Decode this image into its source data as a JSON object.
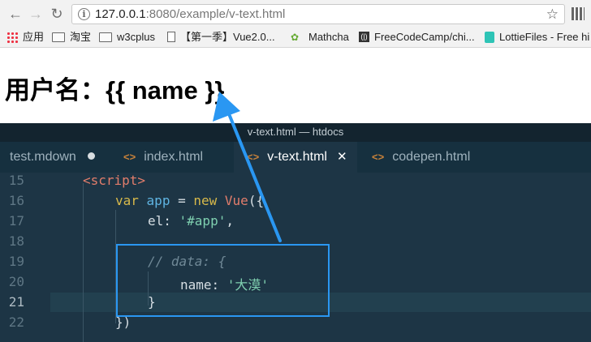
{
  "browser": {
    "url_host": "127.0.0.1",
    "url_rest": ":8080/example/v-text.html",
    "bookmarks": [
      "应用",
      "淘宝",
      "w3cplus",
      "【第一季】Vue2.0...",
      "Mathcha",
      "FreeCodeCamp/chi...",
      "LottieFiles - Free hi"
    ],
    "nav_back": "←",
    "nav_forward": "→",
    "nav_reload": "↻",
    "star": "☆"
  },
  "page": {
    "heading": "用户名：{{ name }}"
  },
  "editor": {
    "window_title": "v-text.html — htdocs",
    "tabs": [
      {
        "label": "test.mdown",
        "modified": true
      },
      {
        "label": "index.html"
      },
      {
        "label": "v-text.html",
        "active": true,
        "close": "✕"
      },
      {
        "label": "codepen.html"
      }
    ],
    "code_icon": "<>",
    "line_numbers": [
      "15",
      "16",
      "17",
      "18",
      "19",
      "20",
      "21",
      "22"
    ],
    "code": {
      "l15": "<script>",
      "l16_kw1": "var",
      "l16_var": "app",
      "l16_op": " = ",
      "l16_kw2": "new",
      "l16_cls": "Vue",
      "l16_end": "({",
      "l17_key": "el: ",
      "l17_str": "'#app'",
      "l17_end": ",",
      "l19": "// data: {",
      "l20_key": "name: ",
      "l20_str": "'大漠'",
      "l21": "}",
      "l22": "})"
    }
  },
  "colors": {
    "annotation": "#2a97f2",
    "editor_bg": "#1d3545"
  }
}
